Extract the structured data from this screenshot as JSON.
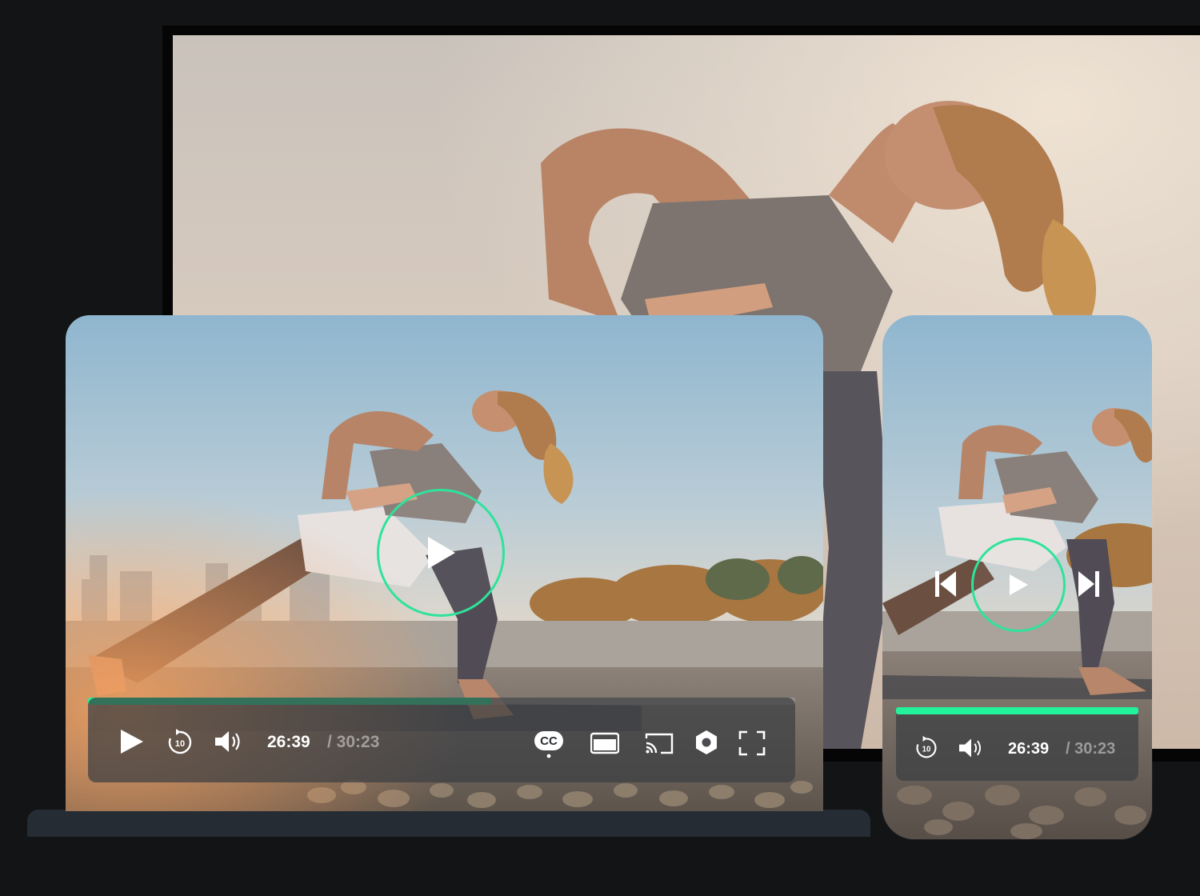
{
  "laptop_player": {
    "current_time": "26:39",
    "total_time": "/ 30:23",
    "progress": 0.57,
    "cc_label": "CC"
  },
  "phone_player": {
    "current_time": "26:39",
    "total_time": "/ 30:23",
    "progress": 1.0
  },
  "icons": [
    "play-icon",
    "replay-10-icon",
    "volume-icon",
    "closed-captions-icon",
    "picture-in-picture-icon",
    "cast-icon",
    "settings-icon",
    "fullscreen-icon",
    "skip-previous-icon",
    "skip-next-icon"
  ],
  "colors": {
    "accent": "#22f29a",
    "play_ring": "#2fe39a",
    "background": "#131416",
    "laptop_base": "#252c33"
  }
}
